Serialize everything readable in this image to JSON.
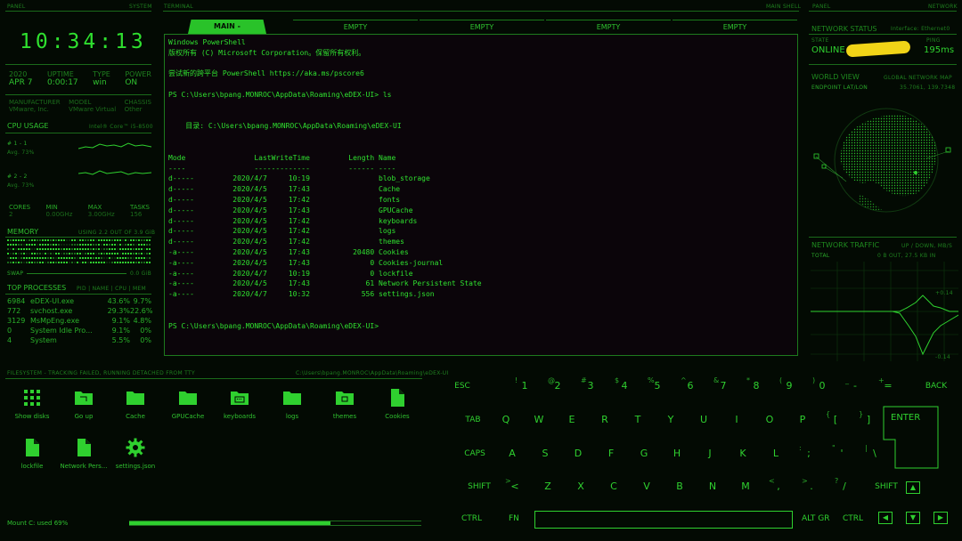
{
  "top_labels": {
    "panel_left": "PANEL",
    "system": "SYSTEM",
    "terminal": "TERMINAL",
    "main_shell": "MAIN SHELL",
    "panel_right": "PANEL",
    "network": "NETWORK"
  },
  "clock": "10:34:13",
  "sysinfo": {
    "cols": [
      {
        "label": "2020",
        "value": "APR 7"
      },
      {
        "label": "UPTIME",
        "value": "0:00:17"
      },
      {
        "label": "TYPE",
        "value": "win"
      },
      {
        "label": "POWER",
        "value": "ON"
      }
    ],
    "manufacturer_label": "MANUFACTURER",
    "manufacturer_value": "VMware, Inc.",
    "model_label": "MODEL",
    "model_value": "VMware Virtual",
    "chassis_label": "CHASSIS",
    "chassis_value": "Other"
  },
  "cpu": {
    "title": "CPU USAGE",
    "model": "Intel® Core™ i5-8500",
    "core1_label": "# 1 - 1",
    "core1_avg": "Avg. 73%",
    "core2_label": "# 2 - 2",
    "core2_avg": "Avg. 73%",
    "stats": [
      {
        "label": "CORES",
        "value": "2"
      },
      {
        "label": "MIN",
        "value": "0.00GHz"
      },
      {
        "label": "MAX",
        "value": "3.00GHz"
      },
      {
        "label": "TASKS",
        "value": "156"
      }
    ]
  },
  "memory": {
    "title": "MEMORY",
    "usage": "USING 2.2 OUT OF 3.9 GiB",
    "swap_label": "SWAP",
    "swap_value": "0.0 GiB"
  },
  "processes": {
    "title": "TOP PROCESSES",
    "header": "PID | NAME | CPU | MEM",
    "rows": [
      {
        "pid": "6984",
        "name": "eDEX-UI.exe",
        "cpu": "43.6%",
        "mem": "9.7%"
      },
      {
        "pid": "772",
        "name": "svchost.exe",
        "cpu": "29.3%",
        "mem": "22.6%"
      },
      {
        "pid": "3129",
        "name": "MsMpEng.exe",
        "cpu": "9.1%",
        "mem": "4.8%"
      },
      {
        "pid": "0",
        "name": "System Idle Pro...",
        "cpu": "9.1%",
        "mem": "0%"
      },
      {
        "pid": "4",
        "name": "System",
        "cpu": "5.5%",
        "mem": "0%"
      }
    ]
  },
  "terminal": {
    "tabs": [
      "MAIN -",
      "EMPTY",
      "EMPTY",
      "EMPTY",
      "EMPTY"
    ],
    "output": "Windows PowerShell\n版权所有 (C) Microsoft Corporation。保留所有权利。\n\n尝试新的跨平台 PowerShell https://aka.ms/pscore6\n\nPS C:\\Users\\bpang.MONROC\\AppData\\Roaming\\eDEX-UI> ls\n\n\n    目录: C:\\Users\\bpang.MONROC\\AppData\\Roaming\\eDEX-UI\n\n\nMode                LastWriteTime         Length Name\n----                -------------         ------ ----\nd-----         2020/4/7     10:19                blob_storage\nd-----         2020/4/5     17:43                Cache\nd-----         2020/4/5     17:42                fonts\nd-----         2020/4/5     17:43                GPUCache\nd-----         2020/4/5     17:42                keyboards\nd-----         2020/4/5     17:42                logs\nd-----         2020/4/5     17:42                themes\n-a----         2020/4/5     17:43          20480 Cookies\n-a----         2020/4/5     17:43              0 Cookies-journal\n-a----         2020/4/7     10:19              0 lockfile\n-a----         2020/4/5     17:43             61 Network Persistent State\n-a----         2020/4/7     10:32            556 settings.json\n\n\nPS C:\\Users\\bpang.MONROC\\AppData\\Roaming\\eDEX-UI>"
  },
  "network_status": {
    "title": "NETWORK STATUS",
    "interface": "Interface: Ethernet0",
    "state_label": "STATE",
    "state_value": "ONLINE",
    "ping_label": "PING",
    "ping_value": "195ms"
  },
  "world_view": {
    "title": "WORLD VIEW",
    "subtitle": "GLOBAL NETWORK MAP",
    "endpoint_label": "ENDPOINT LAT/LON",
    "endpoint_value": "35.7061, 139.7348"
  },
  "traffic": {
    "title": "NETWORK TRAFFIC",
    "subtitle": "UP / DOWN, MB/S",
    "total_label": "TOTAL",
    "total_value": "0 B OUT, 27.5 KB IN",
    "scale_top": "+0.14",
    "scale_bottom": "-0.14"
  },
  "filesystem": {
    "title": "FILESYSTEM - TRACKING FAILED, RUNNING DETACHED FROM TTY",
    "path": "C:\\Users\\bpang.MONROC\\AppData\\Roaming\\eDEX-UI",
    "items": [
      {
        "label": "Show disks",
        "icon": "grid-icon"
      },
      {
        "label": "Go up",
        "icon": "folder-up-icon"
      },
      {
        "label": "Cache",
        "icon": "folder-icon"
      },
      {
        "label": "GPUCache",
        "icon": "folder-icon"
      },
      {
        "label": "keyboards",
        "icon": "keyboard-folder-icon"
      },
      {
        "label": "logs",
        "icon": "folder-icon"
      },
      {
        "label": "themes",
        "icon": "themes-folder-icon"
      },
      {
        "label": "Cookies",
        "icon": "file-icon"
      },
      {
        "label": "lockfile",
        "icon": "file-icon"
      },
      {
        "label": "Network Pers...",
        "icon": "file-icon"
      },
      {
        "label": "settings.json",
        "icon": "gear-icon"
      }
    ],
    "mount": "Mount C: used 69%",
    "usage_fraction": 0.69
  },
  "keyboard": {
    "row1": [
      {
        "k": "ESC"
      },
      {
        "k": "1",
        "s": "!"
      },
      {
        "k": "2",
        "s": "@"
      },
      {
        "k": "3",
        "s": "#"
      },
      {
        "k": "4",
        "s": "$"
      },
      {
        "k": "5",
        "s": "%"
      },
      {
        "k": "6",
        "s": "^"
      },
      {
        "k": "7",
        "s": "&"
      },
      {
        "k": "8",
        "s": "*"
      },
      {
        "k": "9",
        "s": "("
      },
      {
        "k": "0",
        "s": ")"
      },
      {
        "k": "-",
        "s": "_"
      },
      {
        "k": "=",
        "s": "+"
      },
      {
        "k": "BACK"
      }
    ],
    "row2": [
      {
        "k": "TAB"
      },
      {
        "k": "Q"
      },
      {
        "k": "W"
      },
      {
        "k": "E"
      },
      {
        "k": "R"
      },
      {
        "k": "T"
      },
      {
        "k": "Y"
      },
      {
        "k": "U"
      },
      {
        "k": "I"
      },
      {
        "k": "O"
      },
      {
        "k": "P"
      },
      {
        "k": "[",
        "s": "{"
      },
      {
        "k": "]",
        "s": "}"
      }
    ],
    "row3": [
      {
        "k": "CAPS"
      },
      {
        "k": "A"
      },
      {
        "k": "S"
      },
      {
        "k": "D"
      },
      {
        "k": "F"
      },
      {
        "k": "G"
      },
      {
        "k": "H"
      },
      {
        "k": "J"
      },
      {
        "k": "K"
      },
      {
        "k": "L"
      },
      {
        "k": ";",
        "s": ":"
      },
      {
        "k": "'",
        "s": "\""
      },
      {
        "k": "\\",
        "s": "|"
      }
    ],
    "row4": [
      {
        "k": "SHIFT"
      },
      {
        "k": "<",
        "s": ">"
      },
      {
        "k": "Z"
      },
      {
        "k": "X"
      },
      {
        "k": "C"
      },
      {
        "k": "V"
      },
      {
        "k": "B"
      },
      {
        "k": "N"
      },
      {
        "k": "M"
      },
      {
        "k": ",",
        "s": "<"
      },
      {
        "k": ".",
        "s": ">"
      },
      {
        "k": "/",
        "s": "?"
      },
      {
        "k": "SHIFT"
      }
    ],
    "enter": "ENTER",
    "ctrl": "CTRL",
    "fn": "FN",
    "altgr": "ALT GR",
    "ctrl_right": "CTRL",
    "arrows": {
      "up": "▲",
      "left": "◀",
      "down": "▼",
      "right": "▶"
    }
  }
}
